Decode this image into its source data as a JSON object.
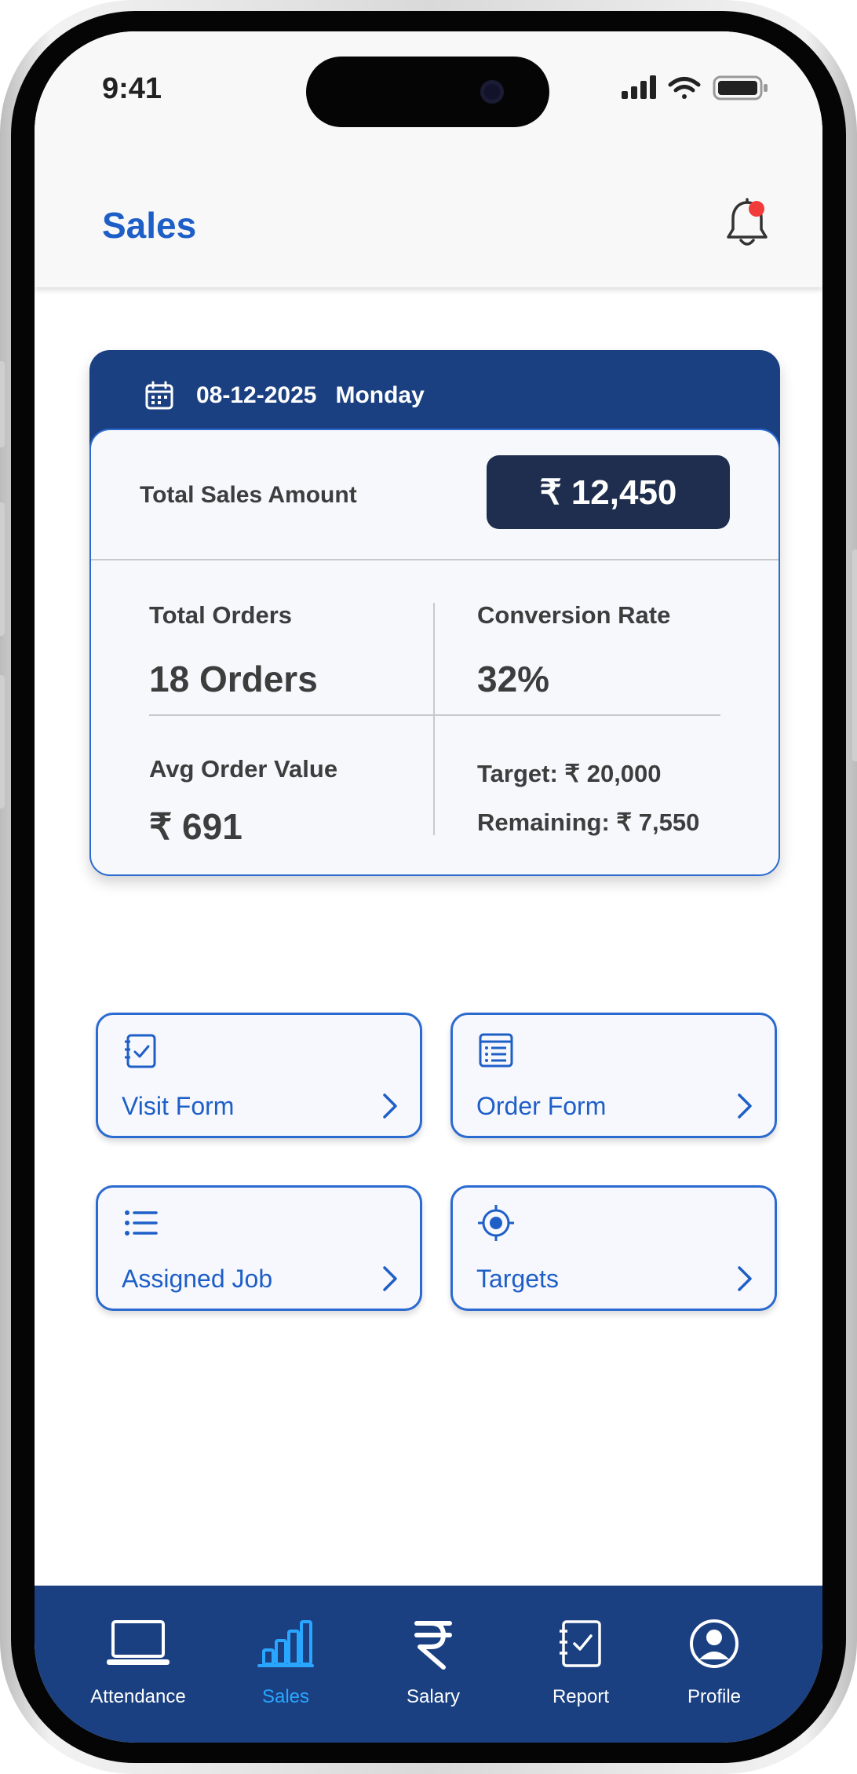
{
  "status_bar": {
    "time": "9:41"
  },
  "header": {
    "title": "Sales"
  },
  "summary_card": {
    "date": "08-12-2025",
    "day": "Monday",
    "total_sales_label": "Total Sales Amount",
    "total_sales_value": "₹ 12,450",
    "total_orders_label": "Total Orders",
    "total_orders_value": "18 Orders",
    "conversion_label": "Conversion Rate",
    "conversion_value": "32%",
    "avg_order_label": "Avg Order Value",
    "avg_order_value": "₹ 691",
    "target_text": "Target: ₹ 20,000",
    "remaining_text": "Remaining: ₹ 7,550"
  },
  "tiles": [
    {
      "label": "Visit Form",
      "icon": "checklist-notebook-icon"
    },
    {
      "label": "Order Form",
      "icon": "list-document-icon"
    },
    {
      "label": "Assigned Job",
      "icon": "bullet-list-icon"
    },
    {
      "label": "Targets",
      "icon": "target-icon"
    }
  ],
  "bottom_nav": {
    "active_color": "#29a6ff",
    "items": [
      {
        "label": "Attendance",
        "icon": "laptop-icon"
      },
      {
        "label": "Sales",
        "icon": "bar-chart-icon",
        "active": true
      },
      {
        "label": "Salary",
        "icon": "rupee-icon"
      },
      {
        "label": "Report",
        "icon": "report-icon"
      },
      {
        "label": "Profile",
        "icon": "user-circle-icon"
      }
    ]
  },
  "colors": {
    "primary": "#1a4082",
    "accent": "#1e5fc7",
    "notification": "#f23b3b",
    "pill": "#1f2e4e"
  }
}
